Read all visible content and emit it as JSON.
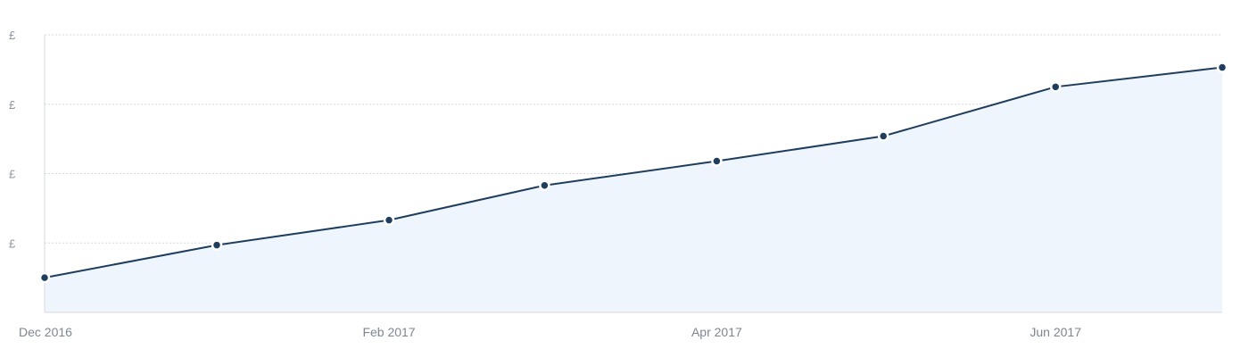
{
  "chart_data": {
    "type": "area",
    "title": "",
    "xlabel": "",
    "ylabel": "",
    "y_tick_labels": [
      "£",
      "£",
      "£",
      "£"
    ],
    "x_tick_labels": [
      "Dec 2016",
      "Feb 2017",
      "Apr 2017",
      "Jun 2017"
    ],
    "x_ticks": [
      "2016-12-01",
      "2017-02-01",
      "2017-04-01",
      "2017-06-01"
    ],
    "x_range": [
      "2016-12-01",
      "2017-07-01"
    ],
    "ylim": [
      0,
      4
    ],
    "grid": true,
    "legend": "none",
    "series": [
      {
        "x": [
          "2016-12-01",
          "2017-01-01",
          "2017-02-01",
          "2017-03-01",
          "2017-04-01",
          "2017-05-01",
          "2017-06-01",
          "2017-07-01"
        ],
        "values": [
          0.5,
          0.97,
          1.33,
          1.83,
          2.18,
          2.54,
          3.25,
          3.53
        ]
      }
    ],
    "colors": {
      "line": "#1f3d5c",
      "point": "#1f3d5c",
      "area": "#eef5fc",
      "grid": "#d4d9de",
      "text": "#8f97a0"
    }
  }
}
